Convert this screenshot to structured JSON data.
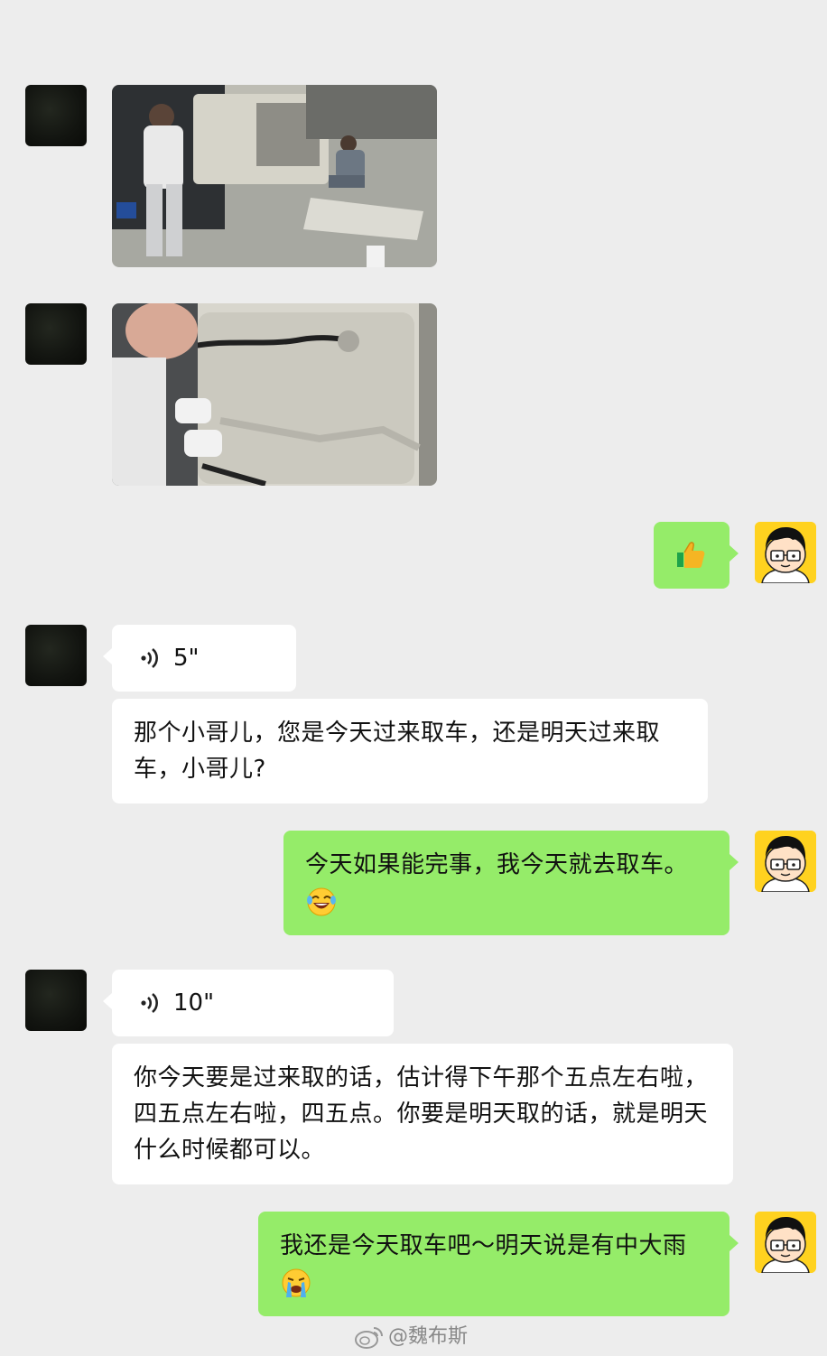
{
  "messages": {
    "voice1": {
      "duration": "5\""
    },
    "text1": "那个小哥儿，您是今天过来取车，还是明天过来取车，小哥儿?",
    "reply1": "今天如果能完事，我今天就去取车。",
    "voice2": {
      "duration": "10\""
    },
    "text2": "你今天要是过来取的话，估计得下午那个五点左右啦，四五点左右啦，四五点。你要是明天取的话，就是明天什么时候都可以。",
    "reply2": "我还是今天取车吧～明天说是有中大雨"
  },
  "watermark": "@魏布斯",
  "colors": {
    "background": "#ededed",
    "bubble_sent": "#95ec69",
    "bubble_received": "#ffffff",
    "avatar_self_bg": "#ffd21f"
  },
  "icons": [
    "thumbs-up-emoji",
    "laugh-tears-emoji",
    "crying-emoji",
    "voice-wave-icon",
    "weibo-icon"
  ]
}
